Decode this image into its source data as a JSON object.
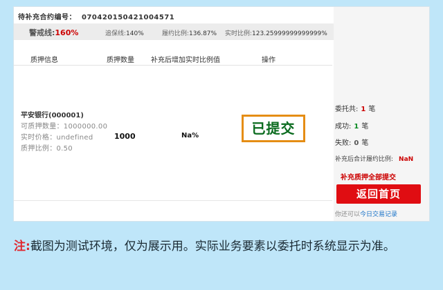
{
  "contract": {
    "label": "待补充合约编号：",
    "number": "070420150421004571"
  },
  "ratios": {
    "warning_label": "警戒线:",
    "warning_value": "160%",
    "maintain_label": "追保线:",
    "maintain_value": "140%",
    "performance_label": "履约比例:",
    "performance_value": "136.87%",
    "realtime_label": "实时比例:",
    "realtime_value": "123.25999999999999%"
  },
  "table": {
    "headers": [
      "质押信息",
      "质押数量",
      "补充后增加实时比例值",
      "操作"
    ],
    "row": {
      "stock_name": "平安银行(000001)",
      "available_qty": "可质押数量：1000000.00",
      "realtime_price": "实时价格：undefined",
      "pledge_ratio": "质押比例：0.50",
      "pledge_qty": "1000",
      "added_ratio": "Na%",
      "action": "已提交"
    }
  },
  "summary": {
    "entrusted_label": "委托共:",
    "entrusted_count": "1",
    "entrusted_unit": "笔",
    "success_label": "成功:",
    "success_count": "1",
    "success_unit": "笔",
    "fail_label": "失败:",
    "fail_count": "0",
    "fail_unit": "笔",
    "total_ratio_label": "补充后合计履约比例:",
    "total_ratio_value": "NaN",
    "all_submitted": "补充质押全部提交",
    "back_button": "返回首页",
    "today_prefix": "你还可以",
    "today_link": "今日交易记录"
  },
  "note": {
    "prefix": "注:",
    "text": "截图为测试环境，仅为展示用。实际业务要素以委托时系统显示为准。"
  }
}
